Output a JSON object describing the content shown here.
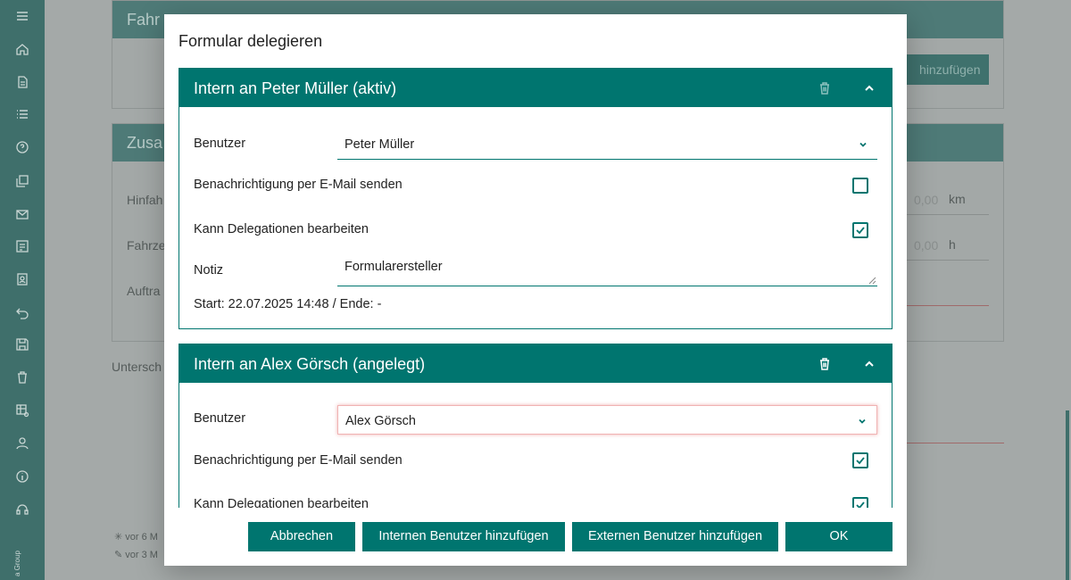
{
  "background": {
    "sidebar_icons": [
      "menu-icon",
      "home-icon",
      "document-icon",
      "list-icon",
      "help-icon",
      "copy-icon",
      "mail-icon",
      "form-icon",
      "badge-icon",
      "undo-icon",
      "save-icon",
      "trash-icon",
      "table-settings-icon",
      "user-icon",
      "info-icon",
      "headset-icon"
    ],
    "brand_text": "a Group",
    "card1_title": "Fahr",
    "card2_title": "Zusa",
    "add_button": "hinzufügen",
    "hinfahrt_label": "Hinfah",
    "fahrzeit_label": "Fahrze",
    "auftrag_label": "Auftra",
    "km_value": "0,00",
    "km_unit": "km",
    "h_value": "0,00",
    "h_unit": "h",
    "unterschrift_label": "Untersch",
    "created_text": "vor 6 M",
    "edited_text": "vor 3 M"
  },
  "dialog": {
    "title": "Formular delegieren",
    "delegations": [
      {
        "title": "Intern an Peter Müller (aktiv)",
        "user_label": "Benutzer",
        "user_value": "Peter Müller",
        "email_label": "Benachrichtigung per E-Mail senden",
        "email_checked": false,
        "edit_label": "Kann Delegationen bearbeiten",
        "edit_checked": true,
        "note_label": "Notiz",
        "note_value": "Formularersteller",
        "start_text": "Start: 22.07.2025 14:48 / Ende: -"
      },
      {
        "title": "Intern an Alex Görsch (angelegt)",
        "user_label": "Benutzer",
        "user_value": "Alex Görsch",
        "email_label": "Benachrichtigung per E-Mail senden",
        "email_checked": true,
        "edit_label": "Kann Delegationen bearbeiten",
        "edit_checked": true
      }
    ],
    "buttons": {
      "cancel": "Abbrechen",
      "add_internal": "Internen Benutzer hinzufügen",
      "add_external": "Externen Benutzer hinzufügen",
      "ok": "OK"
    }
  },
  "colors": {
    "primary": "#00756f",
    "error_border": "#f0b3b3",
    "overlay": "#8a9a99"
  }
}
